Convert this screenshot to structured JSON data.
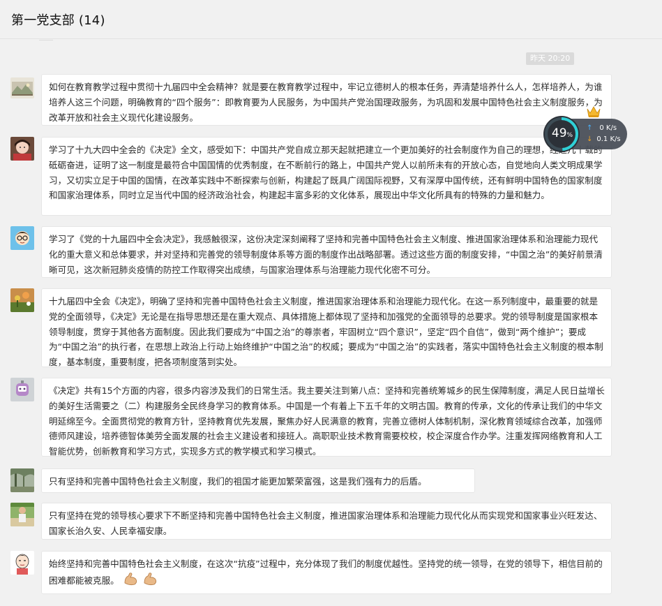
{
  "header": {
    "title": "第一党支部 (14)"
  },
  "timestamp": "昨天 20:20",
  "net_widget": {
    "percent": "49",
    "percent_sign": "%",
    "up_speed": "0 K/s",
    "down_speed": "0.1 K/s",
    "up_arrow": "↑",
    "down_arrow": "↓"
  },
  "messages": [
    {
      "text": "如何在教育教学过程中贯彻十九届四中全会精神？就是要在教育教学过程中，牢记立德树人的根本任务，弄清楚培养什么人，怎样培养人，为谁培养人这三个问题，明确教育的“四个服务”：即教育要为人民服务，为中国共产党治国理政服务，为巩固和发展中国特色社会主义制度服务，为改革开放和社会主义现代化建设服务。",
      "avatar": "photo-landscape"
    },
    {
      "text": "学习了十九大四中全会的《决定》全文，感受如下：中国共产党自成立那天起就把建立一个更加美好的社会制度作为自己的理想，经过几十载的砥砺奋进，证明了这一制度是最符合中国国情的优秀制度，在不断前行的路上，中国共产党人以前所未有的开放心态，自觉地向人类文明成果学习，又切实立足于中国的国情，在改革实践中不断探索与创新，构建起了既具广阔国际视野，又有深厚中国传统，还有鲜明中国特色的国家制度和国家治理体系，同时立足当代中国的经济政治社会，构建起丰富多彩的文化体系，展现出中华文化所具有的特殊的力量和魅力。",
      "avatar": "photo-portrait"
    },
    {
      "text": "学习了《党的十九届四中全会决定》，我感触很深，这份决定深刻阐释了坚持和完善中国特色社会主义制度、推进国家治理体系和治理能力现代化的重大意义和总体要求，并对坚持和完善党的领导制度体系等方面的制度作出战略部署。透过这些方面的制度安排，“中国之治”的美好前景清晰可见，这次新冠肺炎疫情的防控工作取得突出成绩，与国家治理体系与治理能力现代化密不可分。",
      "avatar": "cartoon-glasses"
    },
    {
      "text": "十九届四中全会《决定》，明确了坚持和完善中国特色社会主义制度，推进国家治理体系和治理能力现代化。在这一系列制度中，最重要的就是党的全面领导，《决定》无论是在指导思想还是在重大观点、具体措施上都体现了坚持和加强党的全面领导的总要求。党的领导制度是国家根本领导制度，贯穿于其他各方面制度。因此我们要成为“中国之治”的尊崇者，牢固树立“四个意识”，坚定“四个自信”，做到“两个维护”；要成为“中国之治”的执行者，在思想上政治上行动上始终维护“中国之治”的权威；要成为“中国之治”的实践者，落实中国特色社会主义制度的根本制度，基本制度，重要制度，把各项制度落到实处。",
      "avatar": "photo-flowers"
    },
    {
      "text": "《决定》共有15个方面的内容，很多内容涉及我们的日常生活。我主要关注到第八点：坚持和完善统筹城乡的民生保障制度，满足人民日益增长的美好生活需要之（二）构建服务全民终身学习的教育体系。中国是一个有着上下五千年的文明古国。教育的传承，文化的传承让我们的中华文明延绵至今。全面贯彻党的教育方针，坚持教育优先发展，聚焦办好人民满意的教育，完善立德树人体制机制，深化教育领域综合改革，加强师德师风建设，培养德智体美劳全面发展的社会主义建设者和接班人。高职职业技术教育需要校校，校企深度合作办学。注重发挥网络教育和人工智能优势，创新教育和学习方式，实现多方式的教学模式和学习模式。",
      "avatar": "photo-robot"
    },
    {
      "text": "只有坚持和完善中国特色社会主义制度，我们的祖国才能更加繁荣富强，这是我们强有力的后盾。",
      "avatar": "photo-trees"
    },
    {
      "text": "只有坚持在党的领导核心要求下不断坚持和完善中国特色社会主义制度，推进国家治理体系和治理能力现代化从而实现党和国家事业兴旺发达、国家长治久安、人民幸福安康。",
      "avatar": "photo-person"
    },
    {
      "text": "始终坚持和完善中国特色社会主义制度，在这次“抗疫”过程中，充分体现了我们的制度优越性。坚持党的统一领导，在党的领导下，相信目前的困难都能被克服。",
      "avatar": "cartoon-boy",
      "emoji": [
        "flexed-biceps-emoji",
        "flexed-biceps-emoji"
      ]
    }
  ]
}
